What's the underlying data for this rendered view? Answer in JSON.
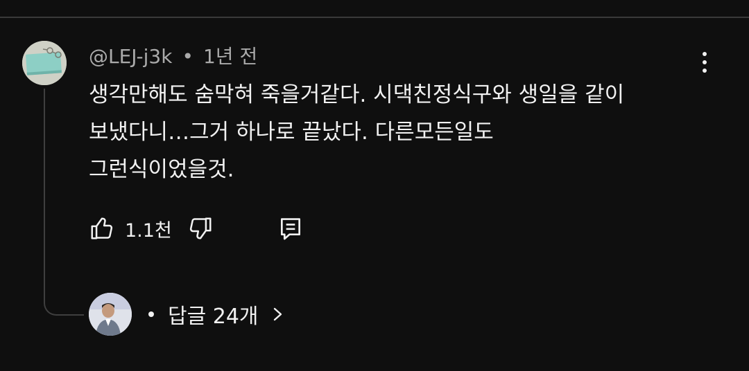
{
  "comment": {
    "author": "@LEJ-j3k",
    "separator": "•",
    "time": "1년 전",
    "text_lines": [
      "생각만해도 숨막혀 죽을거같다. 시댁친정식구와 생일을 같이",
      "보냈다니…그거 하나로 끝났다. 다른모든일도",
      "그런식이었을것."
    ],
    "like_count": "1.1천"
  },
  "replies": {
    "separator": "•",
    "label": "답글 24개"
  },
  "icons": {
    "more": "more-vertical-icon",
    "like": "thumbs-up-icon",
    "dislike": "thumbs-down-icon",
    "reply": "reply-comment-icon",
    "chevron": "chevron-right-icon"
  },
  "colors": {
    "background": "#0f0f0f",
    "text": "#f1f1f1",
    "meta": "#aaaaaa",
    "avatar_bg": "#cfd1c6",
    "avatar_card": "#8dcfc5"
  }
}
